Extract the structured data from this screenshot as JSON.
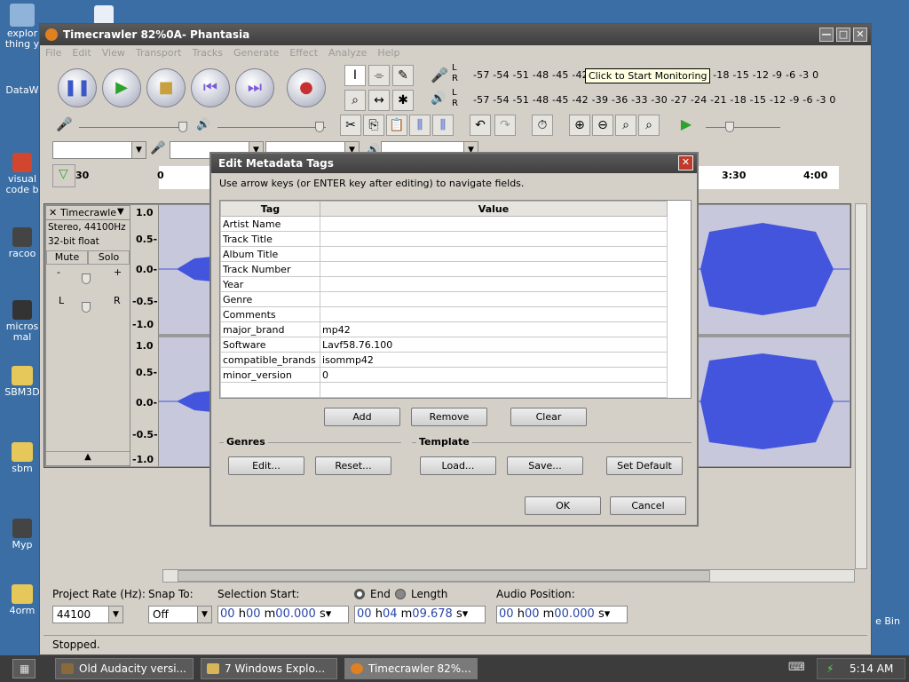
{
  "desktop": {
    "icons": [
      {
        "label": "explor thing y"
      },
      {
        "label": "DataW"
      },
      {
        "label": "visual code b"
      },
      {
        "label": "racoo"
      },
      {
        "label": "micros mal"
      },
      {
        "label": "SBM3D"
      },
      {
        "label": "sbm"
      },
      {
        "label": "Myp"
      },
      {
        "label": "4orm"
      },
      {
        "label": "e Bin"
      }
    ]
  },
  "window": {
    "title": "Timecrawler 82%0A- Phantasia",
    "controls": {
      "minimize": "—",
      "maximize": "□",
      "close": "✕"
    }
  },
  "menu": [
    "File",
    "Edit",
    "View",
    "Transport",
    "Tracks",
    "Generate",
    "Effect",
    "Analyze",
    "Help"
  ],
  "meters": {
    "top_scale": "-57 -54 -51 -48 -45 -42 -3",
    "top_scale_right": "21 -18 -15 -12  -9  -6  -3  0",
    "bottom_scale": "-57 -54 -51 -48 -45 -42 -39 -36 -33 -30 -27 -24 -21 -18 -15 -12  -9  -6  -3  0",
    "tooltip": "Click to Start Monitoring",
    "L": "L",
    "R": "R"
  },
  "ruler": {
    "labels": [
      "30",
      "0",
      "3:30",
      "4:00"
    ]
  },
  "track": {
    "name": "Timecrawle",
    "info1": "Stereo, 44100Hz",
    "info2": "32-bit float",
    "mute": "Mute",
    "solo": "Solo",
    "gain_minus": "-",
    "gain_plus": "+",
    "pan_left": "L",
    "pan_right": "R",
    "scale": [
      "1.0",
      "0.5-",
      "0.0-",
      "-0.5-",
      "-1.0",
      "1.0",
      "0.5-",
      "0.0-",
      "-0.5-",
      "-1.0"
    ]
  },
  "dialog": {
    "title": "Edit Metadata Tags",
    "instruction": "Use arrow keys (or ENTER key after editing) to navigate fields.",
    "columns": {
      "tag": "Tag",
      "value": "Value"
    },
    "rows": [
      {
        "tag": "Artist Name",
        "value": ""
      },
      {
        "tag": "Track Title",
        "value": ""
      },
      {
        "tag": "Album Title",
        "value": ""
      },
      {
        "tag": "Track Number",
        "value": ""
      },
      {
        "tag": "Year",
        "value": ""
      },
      {
        "tag": "Genre",
        "value": ""
      },
      {
        "tag": "Comments",
        "value": ""
      },
      {
        "tag": "major_brand",
        "value": "mp42"
      },
      {
        "tag": "Software",
        "value": "Lavf58.76.100"
      },
      {
        "tag": "compatible_brands",
        "value": "isommp42"
      },
      {
        "tag": "minor_version",
        "value": "0"
      },
      {
        "tag": "",
        "value": ""
      }
    ],
    "buttons": {
      "add": "Add",
      "remove": "Remove",
      "clear": "Clear",
      "genres_edit": "Edit...",
      "genres_reset": "Reset...",
      "template_load": "Load...",
      "template_save": "Save...",
      "template_default": "Set Default",
      "ok": "OK",
      "cancel": "Cancel"
    },
    "groups": {
      "genres": "Genres",
      "template": "Template"
    }
  },
  "selection_bar": {
    "project_rate_label": "Project Rate (Hz):",
    "project_rate": "44100",
    "snap_label": "Snap To:",
    "snap_value": "Off",
    "selection_start_label": "Selection Start:",
    "end_label": "End",
    "length_label": "Length",
    "audio_position_label": "Audio Position:",
    "start": {
      "h": "00",
      "m": "00",
      "s": "00.000"
    },
    "end": {
      "h": "00",
      "m": "04",
      "s": "09.678"
    },
    "position": {
      "h": "00",
      "m": "00",
      "s": "00.000"
    },
    "units": {
      "h": "h",
      "m": "m",
      "s": "s"
    }
  },
  "status": "Stopped.",
  "taskbar": {
    "tasks": [
      "Old Audacity versi...",
      "7 Windows Explo...",
      "Timecrawler 82%..."
    ],
    "clock": "5:14 AM"
  }
}
